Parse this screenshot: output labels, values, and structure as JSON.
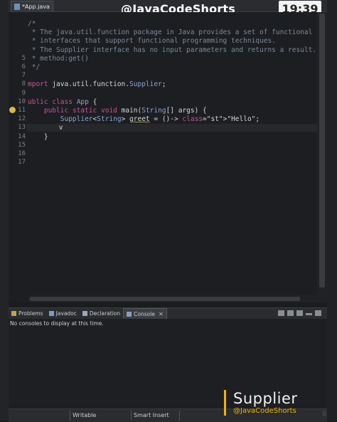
{
  "overlay": {
    "handle": "@JavaCodeShorts",
    "clock": "19:39",
    "caption_title": "Supplier",
    "caption_handle": "@JavaCodeShorts",
    "accent_color": "#f2b300"
  },
  "editor": {
    "tab_label": "*App.java",
    "tab_icon": "java-file-icon",
    "line_numbers": [
      "5",
      "6",
      "7",
      "8",
      "9",
      "10",
      "11",
      "12",
      "13",
      "14",
      "15",
      "16",
      "17"
    ],
    "lines": [
      "/*",
      " * The java.util.function package in Java provides a set of functional",
      " * interfaces that support functional programming techniques.",
      " * The Supplier interface has no input parameters and returns a result.",
      " * method:get()",
      " */",
      "",
      "mport java.util.function.Supplier;",
      "",
      "ublic class App {",
      "    public static void main(String[] args) {",
      "        Supplier<String> greet = ()-> \"Hello\";",
      "        v",
      "    }",
      "",
      "",
      ""
    ],
    "warning_icon": "lightbulb-warning-icon"
  },
  "panel": {
    "tabs": [
      {
        "label": "Problems",
        "icon": "problems-icon"
      },
      {
        "label": "Javadoc",
        "icon": "javadoc-icon"
      },
      {
        "label": "Declaration",
        "icon": "declaration-icon"
      },
      {
        "label": "Console",
        "icon": "console-icon",
        "active": true
      }
    ],
    "message": "No consoles to display at this time."
  },
  "status": {
    "mode": "Writable",
    "insert": "Smart Insert"
  }
}
